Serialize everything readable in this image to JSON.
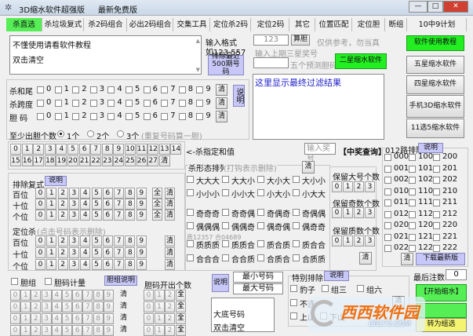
{
  "window": {
    "title": "3D缩水软件超强版",
    "subtitle": "最新免费版",
    "minimize": "—",
    "maximize": "□",
    "close": "✕"
  },
  "tabs": [
    {
      "label": "杀直选",
      "active": true
    },
    {
      "label": "杀垃圾复式"
    },
    {
      "label": "杀2码组合"
    },
    {
      "label": "必出2码组合"
    },
    {
      "label": "交集工具"
    },
    {
      "label": "定位杀2码"
    },
    {
      "label": "定位2码"
    },
    {
      "label": "其它"
    },
    {
      "label": "位置匹配"
    },
    {
      "label": "定位胆"
    },
    {
      "label": "断组"
    },
    {
      "label": "10中9计划"
    }
  ],
  "input_box": {
    "line1": "不懂使用请看软件教程",
    "line2": "双击清空"
  },
  "format_hint": {
    "line1": "输入格式",
    "line2": "如123 557"
  },
  "exclude_recent": {
    "line1": "排除最近",
    "line2": "500期号码"
  },
  "kill_rows": [
    {
      "label": "杀和尾"
    },
    {
      "label": "杀跨度"
    },
    {
      "label": "胆 码"
    }
  ],
  "digits": [
    "0",
    "1",
    "2",
    "3",
    "4",
    "5",
    "6",
    "7",
    "8",
    "9"
  ],
  "clear": "清",
  "all": "全",
  "explain": "说明",
  "min_dan": {
    "label": "至少出胆个数",
    "options": [
      "1个",
      "2个",
      "3个"
    ],
    "selected": 0,
    "note": "(重复号码算一胆)"
  },
  "sum_grid": [
    "0",
    "1",
    "2",
    "3",
    "4",
    "5",
    "6",
    "7",
    "8",
    "9",
    "10",
    "11",
    "12",
    "13",
    "14",
    "15",
    "16",
    "17",
    "18",
    "19",
    "20",
    "21",
    "22",
    "23",
    "24",
    "25",
    "26",
    "27"
  ],
  "exclude_compound": {
    "title": "排除复式",
    "rows": [
      "百位",
      "十位",
      "个位"
    ]
  },
  "position_kill": {
    "title": "定位杀",
    "note": "(点击号码表示删除)",
    "rows": [
      "百位",
      "十位",
      "个位"
    ]
  },
  "dan_calc": {
    "value": "123",
    "button": "算胆",
    "note": "仅供参考，勿当真",
    "label": "输入上期三星奖号",
    "predict_value": "",
    "predict_label": "五个预测胆码",
    "two_star": "二星缩水软件"
  },
  "result_box": "这里显示最终过滤结果",
  "side_buttons": [
    "软件使用教程",
    "五星缩水软件",
    "四星缩水软件",
    "手机3D缩水软件",
    "11选5缩水软件"
  ],
  "sum_kill": "<-杀指定和值",
  "lottery": {
    "placeholder": "输入奖号",
    "query": "【中奖查询】"
  },
  "pattern": {
    "title": "杀形态排列",
    "note": "(打钩表示删除)",
    "rows": [
      [
        "大大大",
        "大大小",
        "大小大",
        "大小小"
      ],
      [
        "小小小",
        "小小大",
        "小大小",
        "小大大"
      ],
      [
        "奇奇奇",
        "奇奇偶",
        "奇偶奇",
        "奇偶偶"
      ],
      [
        "偶偶偶",
        "偶偶奇",
        "偶奇偶",
        "偶奇奇"
      ],
      [
        "质质质",
        "质质合",
        "质合质",
        "质合合"
      ],
      [
        "合合合",
        "合合质",
        "合质合",
        "合质质"
      ]
    ],
    "prime_note": "质12357 合04689"
  },
  "keep": {
    "groups": [
      "保留大号个数",
      "保留奇数个数",
      "保留质数个数"
    ],
    "options": [
      "0",
      "1",
      "2",
      "3"
    ]
  },
  "road012": {
    "title": "012路排除",
    "items": [
      [
        "000",
        "100",
        "200"
      ],
      [
        "001",
        "101",
        "201"
      ],
      [
        "002",
        "102",
        "202"
      ],
      [
        "010",
        "110",
        "210"
      ],
      [
        "011",
        "111",
        "211"
      ],
      [
        "012",
        "112",
        "212"
      ],
      [
        "020",
        "120",
        "220"
      ],
      [
        "021",
        "121",
        "221"
      ],
      [
        "022",
        "122",
        "222"
      ]
    ],
    "download": "下载最新版"
  },
  "dan_group": {
    "dan_group": "胆组",
    "dan_count": "胆码计量",
    "dan_explain": "胆组说明",
    "dan_out": "胆码开出个数",
    "out_options": [
      "0",
      "1",
      "2",
      "3"
    ]
  },
  "range": {
    "min": "最小号码",
    "max": "最大号码",
    "line1": "大底号码",
    "line2": "双击清空"
  },
  "special": {
    "title": "特别排除",
    "items": [
      "豹子",
      "组三",
      "组六",
      "不连",
      "上山",
      "下山"
    ]
  },
  "final": {
    "label": "最后注数",
    "value": "0",
    "start": "【开始缩水】",
    "convert": "转为组选"
  },
  "watermark": {
    "text": "西西软件园",
    "url": "CR173.COM"
  },
  "colors": {
    "active_tab": "#55ee55",
    "green_button": "#22ee22",
    "blue_button": "#c8c8f8",
    "result_text": "#2222cc"
  }
}
